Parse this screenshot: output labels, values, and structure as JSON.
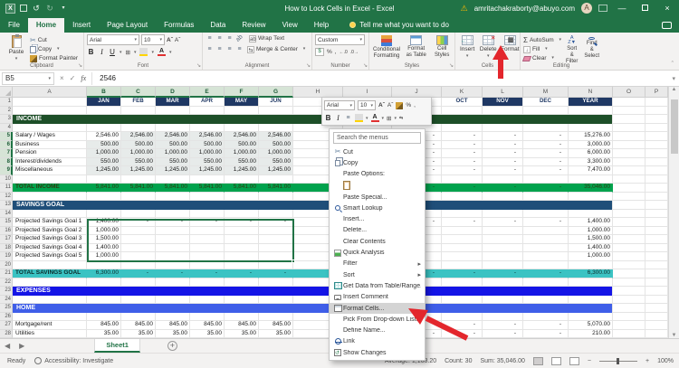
{
  "colors": {
    "excel_green": "#217346",
    "navy": "#1f3864",
    "income_banner": "#1d4f28",
    "total_income_bg": "#00a24d",
    "total_income_text": "#2f3a10",
    "savings_banner": "#1f4e79",
    "total_savings_bg": "#3bc3c3",
    "total_savings_text": "#0d2b2b",
    "expenses_banner": "#1414e6",
    "home_banner": "#3f5ee8",
    "arrow_red": "#e3262c"
  },
  "titlebar": {
    "title": "How to Lock Cells in Excel - Excel",
    "account": "amritachakraborty@abuyo.com",
    "avatar_initial": "A"
  },
  "active_tab": "Home",
  "tabs": [
    "File",
    "Home",
    "Insert",
    "Page Layout",
    "Formulas",
    "Data",
    "Review",
    "View",
    "Help"
  ],
  "tell_me": "Tell me what you want to do",
  "ribbon": {
    "clipboard": {
      "label": "Clipboard",
      "paste": "Paste",
      "cut": "Cut",
      "copy": "Copy",
      "format_painter": "Format Painter"
    },
    "font": {
      "label": "Font",
      "font_name": "Arial",
      "font_size": "10"
    },
    "alignment": {
      "label": "Alignment",
      "wrap_text": "Wrap Text",
      "merge_center": "Merge & Center"
    },
    "number": {
      "label": "Number",
      "format": "Custom"
    },
    "styles": {
      "label": "Styles",
      "conditional_formatting": "Conditional Formatting",
      "format_as_table": "Format as Table",
      "cell_styles": "Cell Styles"
    },
    "cells": {
      "label": "Cells",
      "insert": "Insert",
      "delete": "Delete",
      "format": "Format"
    },
    "editing": {
      "label": "Editing",
      "autosum": "AutoSum",
      "fill": "Fill",
      "clear": "Clear",
      "sort_filter": "Sort & Filter",
      "find_select": "Find & Select"
    }
  },
  "formula_bar": {
    "name_box": "B5",
    "value": "2546"
  },
  "grid": {
    "col_letters": [
      "A",
      "B",
      "C",
      "D",
      "E",
      "F",
      "G",
      "H",
      "I",
      "J",
      "K",
      "L",
      "M",
      "N",
      "O",
      "P"
    ],
    "selected_cols": [
      "B",
      "C",
      "D",
      "E",
      "F",
      "G"
    ],
    "selected_rows": [
      5,
      6,
      7,
      8,
      9
    ],
    "active_cell": "B5",
    "rows": [
      {
        "n": 1,
        "type": "months",
        "dark": [
          "B",
          "D",
          "F",
          "L",
          "N"
        ],
        "cells": {
          "B": "JAN",
          "C": "FEB",
          "D": "MAR",
          "E": "APR",
          "F": "MAY",
          "G": "JUN",
          "K": "OCT",
          "L": "NOV",
          "M": "DEC",
          "N": "YEAR"
        }
      },
      {
        "n": 3,
        "type": "banner",
        "style": "income_banner",
        "label": "INCOME"
      },
      {
        "n": 5,
        "type": "data",
        "label": "Salary / Wages",
        "cells": {
          "B": "2,546.00",
          "C": "2,546.00",
          "D": "2,546.00",
          "E": "2,546.00",
          "F": "2,546.00",
          "G": "2,546.00",
          "H": "-",
          "I": "-",
          "J": "-",
          "K": "-",
          "L": "-",
          "M": "-",
          "N": "15,276.00"
        }
      },
      {
        "n": 6,
        "type": "data",
        "label": "Business",
        "cells": {
          "B": "500.00",
          "C": "500.00",
          "D": "500.00",
          "E": "500.00",
          "F": "500.00",
          "G": "500.00",
          "H": "-",
          "I": "-",
          "J": "-",
          "K": "-",
          "L": "-",
          "M": "-",
          "N": "3,000.00"
        }
      },
      {
        "n": 7,
        "type": "data",
        "label": "Pension",
        "cells": {
          "B": "1,000.00",
          "C": "1,000.00",
          "D": "1,000.00",
          "E": "1,000.00",
          "F": "1,000.00",
          "G": "1,000.00",
          "H": "-",
          "I": "-",
          "J": "-",
          "K": "-",
          "L": "-",
          "M": "-",
          "N": "6,000.00"
        }
      },
      {
        "n": 8,
        "type": "data",
        "label": "Interest/dividends",
        "cells": {
          "B": "550.00",
          "C": "550.00",
          "D": "550.00",
          "E": "550.00",
          "F": "550.00",
          "G": "550.00",
          "H": "-",
          "I": "-",
          "J": "-",
          "K": "-",
          "L": "-",
          "M": "-",
          "N": "3,300.00"
        }
      },
      {
        "n": 9,
        "type": "data",
        "label": "Miscellaneous",
        "cells": {
          "B": "1,245.00",
          "C": "1,245.00",
          "D": "1,245.00",
          "E": "1,245.00",
          "F": "1,245.00",
          "G": "1,245.00",
          "H": "-",
          "I": "-",
          "J": "-",
          "K": "-",
          "L": "-",
          "M": "-",
          "N": "7,470.00"
        }
      },
      {
        "n": 11,
        "type": "total",
        "style": "total_income",
        "label": "TOTAL INCOME",
        "cells": {
          "B": "5,841.00",
          "C": "5,841.00",
          "D": "5,841.00",
          "E": "5,841.00",
          "F": "5,841.00",
          "G": "5,841.00",
          "H": "-",
          "I": "-",
          "J": "-",
          "K": "-",
          "L": "-",
          "M": "-",
          "N": "35,046.00"
        }
      },
      {
        "n": 13,
        "type": "banner",
        "style": "savings_banner",
        "label": "SAVINGS GOAL"
      },
      {
        "n": 15,
        "type": "data",
        "label": "Projected Savings Goal 1",
        "cells": {
          "B": "1,400.00",
          "C": "-",
          "D": "-",
          "E": "-",
          "F": "-",
          "G": "-",
          "H": "-",
          "I": "-",
          "J": "-",
          "K": "-",
          "L": "-",
          "M": "-",
          "N": "1,400.00"
        }
      },
      {
        "n": 16,
        "type": "data",
        "label": "Projected Savings Goal 2",
        "cells": {
          "B": "1,000.00",
          "N": "1,000.00"
        }
      },
      {
        "n": 17,
        "type": "data",
        "label": "Projected Savings Goal 3",
        "cells": {
          "B": "1,500.00",
          "N": "1,500.00"
        }
      },
      {
        "n": 18,
        "type": "data",
        "label": "Projected Savings Goal 4",
        "cells": {
          "B": "1,400.00",
          "N": "1,400.00"
        }
      },
      {
        "n": 19,
        "type": "data",
        "label": "Projected Savings Goal 5",
        "cells": {
          "B": "1,000.00",
          "N": "1,000.00"
        }
      },
      {
        "n": 21,
        "type": "total",
        "style": "total_savings",
        "label": "TOTAL SAVINGS GOAL",
        "cells": {
          "B": "6,300.00",
          "C": "-",
          "D": "-",
          "E": "-",
          "F": "-",
          "G": "-",
          "H": "-",
          "I": "-",
          "J": "-",
          "K": "-",
          "L": "-",
          "M": "-",
          "N": "6,300.00"
        }
      },
      {
        "n": 23,
        "type": "banner",
        "style": "expenses_banner",
        "label": "EXPENSES"
      },
      {
        "n": 25,
        "type": "banner",
        "style": "home_banner",
        "label": "HOME"
      },
      {
        "n": 27,
        "type": "data",
        "label": "Mortgage/rent",
        "cells": {
          "B": "845.00",
          "C": "845.00",
          "D": "845.00",
          "E": "845.00",
          "F": "845.00",
          "G": "845.00",
          "H": "-",
          "I": "-",
          "J": "-",
          "K": "-",
          "L": "-",
          "M": "-",
          "N": "5,070.00"
        }
      },
      {
        "n": 28,
        "type": "data",
        "label": "Utilities",
        "cells": {
          "B": "35.00",
          "C": "35.00",
          "D": "35.00",
          "E": "35.00",
          "F": "35.00",
          "G": "35.00",
          "H": "-",
          "I": "-",
          "J": "-",
          "K": "-",
          "L": "-",
          "M": "-",
          "N": "210.00"
        }
      }
    ]
  },
  "mini_toolbar": {
    "font_name": "Arial",
    "font_size": "10"
  },
  "context_menu": {
    "search_placeholder": "Search the menus",
    "items": [
      {
        "label": "Cut",
        "icon": "scissors-icon"
      },
      {
        "label": "Copy",
        "icon": "copy-icon"
      },
      {
        "label": "Paste Options:"
      },
      {
        "type": "paste-icons"
      },
      {
        "label": "Paste Special..."
      },
      {
        "label": "Smart Lookup",
        "icon": "magnifier-icon"
      },
      {
        "label": "Insert..."
      },
      {
        "label": "Delete..."
      },
      {
        "label": "Clear Contents"
      },
      {
        "label": "Quick Analysis",
        "icon": "quick-analysis-icon"
      },
      {
        "label": "Filter",
        "submenu": true
      },
      {
        "label": "Sort",
        "submenu": true
      },
      {
        "label": "Get Data from Table/Range...",
        "icon": "table-icon"
      },
      {
        "label": "Insert Comment",
        "icon": "comment-icon"
      },
      {
        "label": "Format Cells...",
        "icon": "format-cells-icon",
        "highlight": true
      },
      {
        "label": "Pick From Drop-down List..."
      },
      {
        "label": "Define Name..."
      },
      {
        "label": "Link",
        "icon": "link-icon"
      },
      {
        "label": "Show Changes",
        "icon": "show-changes-icon"
      }
    ]
  },
  "sheet_tabs": {
    "active": "Sheet1"
  },
  "status_bar": {
    "ready": "Ready",
    "accessibility": "Accessibility: Investigate",
    "average": "Average: 1,168.20",
    "count": "Count: 30",
    "sum": "Sum: 35,046.00",
    "zoom": "100%"
  }
}
